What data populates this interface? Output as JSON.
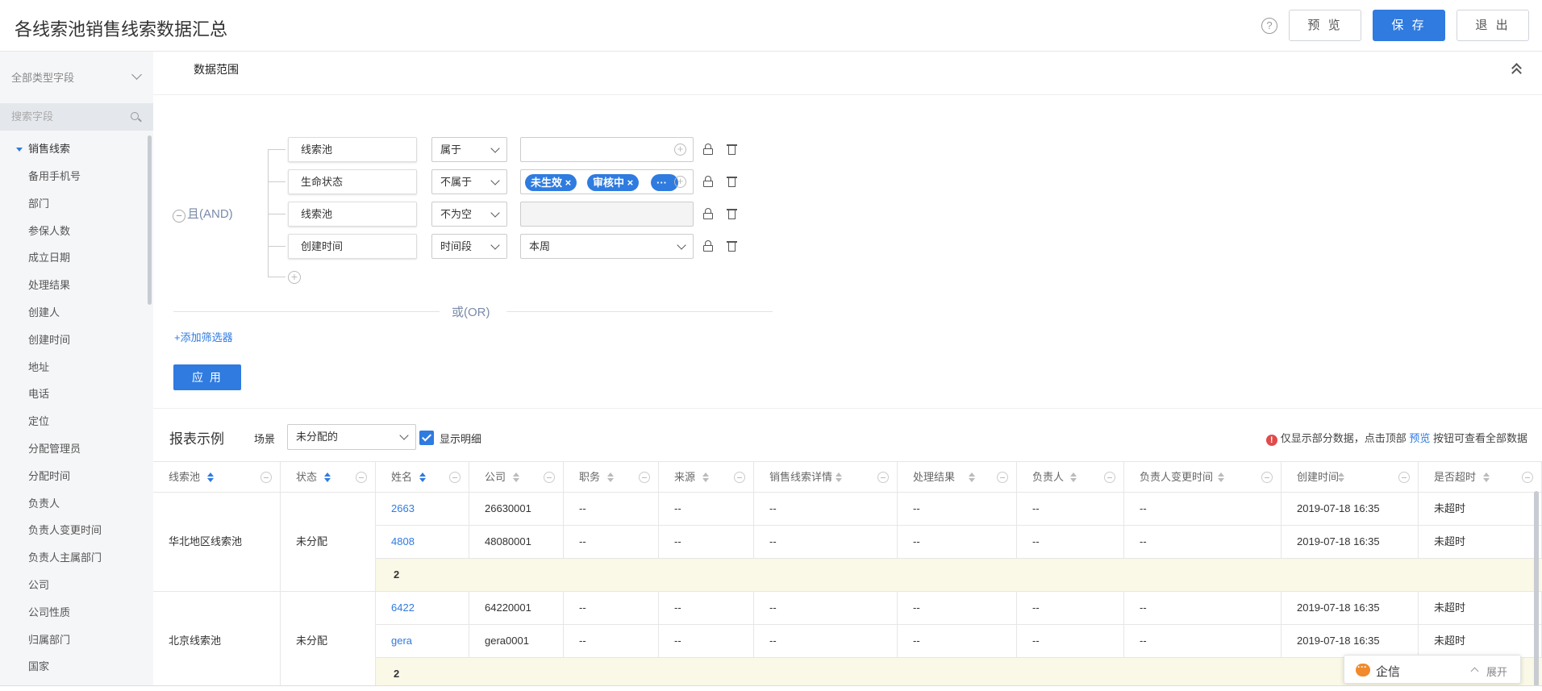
{
  "header": {
    "title": "各线索池销售线索数据汇总",
    "help_glyph": "?",
    "preview_label": "预 览",
    "save_label": "保 存",
    "exit_label": "退 出"
  },
  "sidebar": {
    "type_select": "全部类型字段",
    "search_placeholder": "搜索字段",
    "root_label": "销售线索",
    "items": [
      "备用手机号",
      "部门",
      "参保人数",
      "成立日期",
      "处理结果",
      "创建人",
      "创建时间",
      "地址",
      "电话",
      "定位",
      "分配管理员",
      "分配时间",
      "负责人",
      "负责人变更时间",
      "负责人主属部门",
      "公司",
      "公司性质",
      "归属部门",
      "国家"
    ]
  },
  "filter": {
    "section_title": "数据范围",
    "and_label": "且(AND)",
    "or_label": "或(OR)",
    "add_filter": "+添加筛选器",
    "apply_label": "应 用",
    "conditions": [
      {
        "field": "线索池",
        "op": "属于",
        "value": ""
      },
      {
        "field": "生命状态",
        "op": "不属于",
        "tags": [
          "未生效 ×",
          "审核中 ×",
          "···"
        ]
      },
      {
        "field": "线索池",
        "op": "不为空",
        "value": ""
      },
      {
        "field": "创建时间",
        "op": "时间段",
        "value": "本周"
      }
    ]
  },
  "report": {
    "title": "报表示例",
    "scene_label": "场景",
    "scene_value": "未分配的",
    "show_detail": "显示明细",
    "notice_prefix": "仅显示部分数据，点击顶部",
    "notice_link": "预览",
    "notice_suffix": "按钮可查看全部数据",
    "columns": [
      "线索池",
      "状态",
      "姓名",
      "公司",
      "职务",
      "来源",
      "销售线索详情",
      "处理结果",
      "负责人",
      "负责人变更时间",
      "创建时间",
      "是否超时"
    ],
    "groups": [
      {
        "pool": "华北地区线索池",
        "status": "未分配",
        "rows": [
          {
            "name": "2663",
            "company": "26630001",
            "title": "--",
            "source": "--",
            "detail": "--",
            "result": "--",
            "owner": "--",
            "owner_changed": "--",
            "created": "2019-07-18 16:35",
            "timeout": "未超时"
          },
          {
            "name": "4808",
            "company": "48080001",
            "title": "--",
            "source": "--",
            "detail": "--",
            "result": "--",
            "owner": "--",
            "owner_changed": "--",
            "created": "2019-07-18 16:35",
            "timeout": "未超时"
          }
        ],
        "subtotal": "2"
      },
      {
        "pool": "北京线索池",
        "status": "未分配",
        "rows": [
          {
            "name": "6422",
            "company": "64220001",
            "title": "--",
            "source": "--",
            "detail": "--",
            "result": "--",
            "owner": "--",
            "owner_changed": "--",
            "created": "2019-07-18 16:35",
            "timeout": "未超时"
          },
          {
            "name": "gera",
            "company": "gera0001",
            "title": "--",
            "source": "--",
            "detail": "--",
            "result": "--",
            "owner": "--",
            "owner_changed": "--",
            "created": "2019-07-18 16:35",
            "timeout": "未超时"
          }
        ],
        "subtotal": "2"
      }
    ]
  },
  "qixin": {
    "name": "企信",
    "expand": "展开"
  },
  "colors": {
    "primary": "#2f7be0",
    "subtotal_bg": "#faf8e6",
    "warn": "#e04b4b",
    "qixin": "#f08a2c"
  }
}
